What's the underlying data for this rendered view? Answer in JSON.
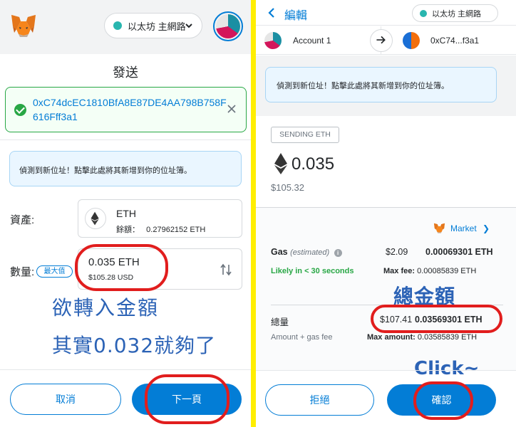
{
  "left": {
    "network": "以太坊 主網路",
    "title": "發送",
    "recipient_address": "0xC74dcEC1810BfA8E87DE4AA798B758F616Fff3a1",
    "new_address_notice": "偵測到新位址！點擊此處將其新增到你的位址簿。",
    "asset_label": "資產:",
    "asset_name": "ETH",
    "asset_balance_label": "餘額：",
    "asset_balance_value": "0.27962152 ETH",
    "amount_label": "數量:",
    "max_label": "最大值",
    "amount_value": "0.035  ETH",
    "amount_usd": "$105.28 USD",
    "annotation_1": "欲轉入金額",
    "annotation_2": "其實0.032就夠了",
    "cancel_label": "取消",
    "next_label": "下一頁"
  },
  "right": {
    "edit_label": "編輯",
    "network": "以太坊 主網路",
    "from_account": "Account 1",
    "to_account": "0xC74...f3a1",
    "new_address_notice": "偵測到新位址！點擊此處將其新增到你的位址簿。",
    "sending_badge": "SENDING ETH",
    "send_amount": "0.035",
    "send_usd": "$105.32",
    "market_label": "Market",
    "gas_label": "Gas",
    "gas_estimated": "(estimated)",
    "gas_usd": "$2.09",
    "gas_eth": "0.00069301 ETH",
    "likely_label": "Likely in < 30 seconds",
    "max_fee_label": "Max fee:",
    "max_fee_value": "0.00085839 ETH",
    "annotation_total": "總金額",
    "total_label": "總量",
    "total_usd": "$107.41",
    "total_eth": "0.03569301 ETH",
    "total_sub": "Amount + gas fee",
    "max_amount_label": "Max amount:",
    "max_amount_value": "0.03585839 ETH",
    "annotation_click": "Click~",
    "reject_label": "拒絕",
    "confirm_label": "確認"
  },
  "colors": {
    "accent": "#037dd6",
    "success": "#28a745",
    "annotation_blue": "#2c63b6",
    "annotation_red": "#e11d1d",
    "divider_yellow": "#ffee00"
  }
}
